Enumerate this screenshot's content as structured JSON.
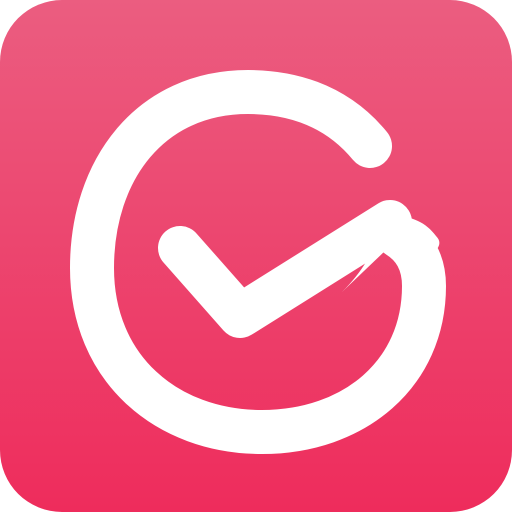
{
  "icon": {
    "name": "checkmark-g-logo",
    "colors": {
      "gradient_top": "#EB5D80",
      "gradient_bottom": "#EE2C5C",
      "mark": "#FFFFFF"
    }
  }
}
